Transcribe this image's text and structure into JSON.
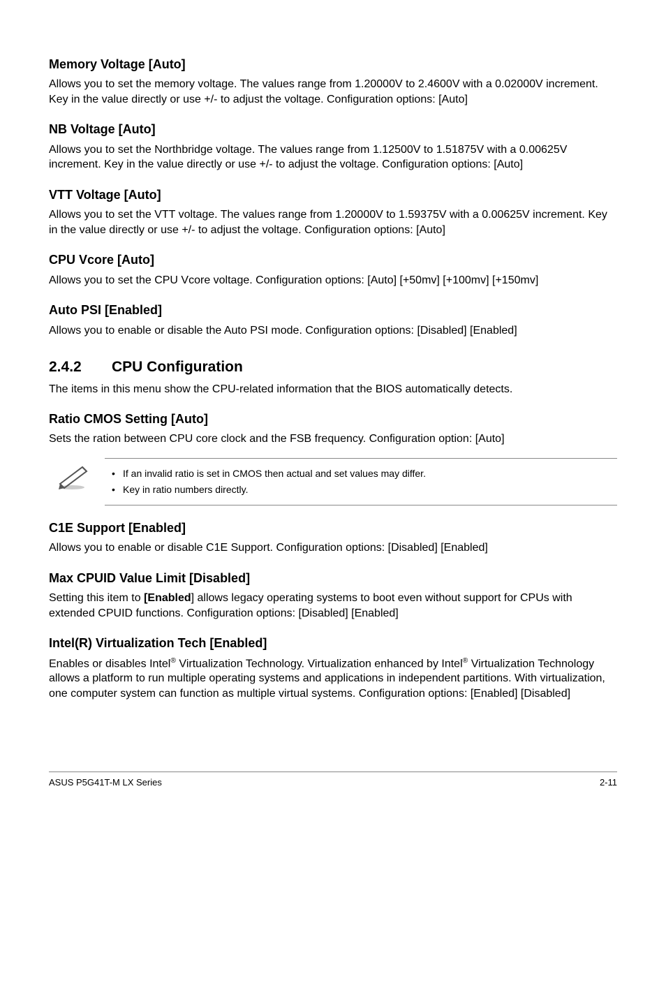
{
  "s1": {
    "heading": "Memory Voltage [Auto]",
    "body": "Allows you to set the memory voltage. The values range from 1.20000V to 2.4600V with a 0.02000V increment. Key in the value directly or use +/- to adjust the voltage. Configuration options: [Auto]"
  },
  "s2": {
    "heading": "NB Voltage [Auto]",
    "body": "Allows you to set the Northbridge voltage. The values range from 1.12500V to 1.51875V with a 0.00625V increment. Key in the value directly or use +/- to adjust the voltage. Configuration options: [Auto]"
  },
  "s3": {
    "heading": "VTT Voltage [Auto]",
    "body": "Allows you to set the VTT voltage. The values range from 1.20000V to 1.59375V with a 0.00625V increment. Key in the value directly or use +/- to adjust the voltage. Configuration options: [Auto]"
  },
  "s4": {
    "heading": "CPU Vcore [Auto]",
    "body": "Allows you to set the CPU Vcore voltage. Configuration options: [Auto] [+50mv] [+100mv] [+150mv]"
  },
  "s5": {
    "heading": "Auto PSI [Enabled]",
    "body": "Allows you to enable or disable the Auto PSI mode. Configuration options: [Disabled] [Enabled]"
  },
  "sec": {
    "num": "2.4.2",
    "title": "CPU Configuration",
    "body": "The items in this menu show the CPU-related information that the BIOS automatically detects."
  },
  "s6": {
    "heading": "Ratio CMOS Setting [Auto]",
    "body": "Sets the ration between CPU core clock and the FSB frequency. Configuration option: [Auto]"
  },
  "note": {
    "b1": "If an invalid ratio is set in CMOS then actual and set values may differ.",
    "b2": "Key in ratio numbers directly."
  },
  "s7": {
    "heading": "C1E Support [Enabled]",
    "body": "Allows you to enable or disable C1E Support. Configuration options: [Disabled] [Enabled]"
  },
  "s8": {
    "heading": "Max CPUID Value Limit [Disabled]",
    "body_pre": "Setting this item to ",
    "body_bold": "[Enabled",
    "body_post": "] allows legacy operating systems to boot even without support for CPUs with extended CPUID functions. Configuration options: [Disabled] [Enabled]"
  },
  "s9": {
    "heading": "Intel(R) Virtualization Tech [Enabled]",
    "p1": "Enables or disables Intel",
    "p2": " Virtualization Technology. Virtualization enhanced by Intel",
    "p3": " Virtualization Technology allows a platform to run multiple operating systems and applications in independent partitions. With virtualization, one computer system can function as multiple virtual systems. Configuration options: [Enabled] [Disabled]"
  },
  "footer": {
    "left": "ASUS P5G41T-M LX Series",
    "right": "2-11"
  }
}
